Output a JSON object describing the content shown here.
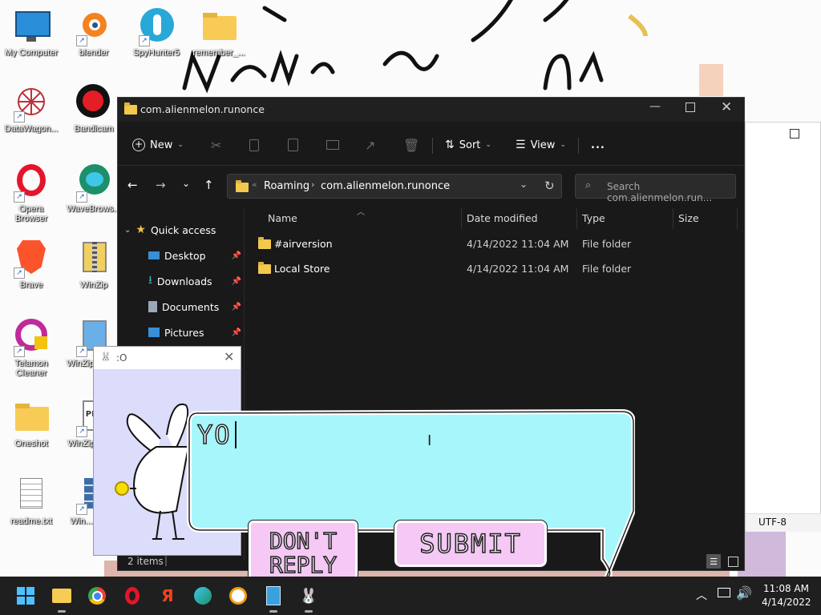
{
  "desktop": {
    "icons": [
      {
        "label": "My Computer"
      },
      {
        "label": "blender"
      },
      {
        "label": "SpyHunter5"
      },
      {
        "label": "remember_..."
      },
      {
        "label": "DataWagon..."
      },
      {
        "label": "Bandicam"
      },
      {
        "label": "Opera Browser"
      },
      {
        "label": "WaveBrows..."
      },
      {
        "label": "Brave"
      },
      {
        "label": "WinZip"
      },
      {
        "label": "Telamon Cleaner"
      },
      {
        "label": "WinZip Man..."
      },
      {
        "label": "Oneshot"
      },
      {
        "label": "WinZip Exp..."
      },
      {
        "label": "readme.txt"
      },
      {
        "label": "Win... Sec..."
      }
    ]
  },
  "explorer": {
    "title": "com.alienmelon.runonce",
    "toolbar": {
      "new": "New",
      "sort": "Sort",
      "view": "View",
      "more": "..."
    },
    "address": {
      "crumb1": "Roaming",
      "crumb2": "com.alienmelon.runonce",
      "overflow": "«"
    },
    "search": {
      "placeholder": "Search com.alienmelon.run..."
    },
    "nav": {
      "quick_access": "Quick access",
      "items": [
        {
          "label": "Desktop"
        },
        {
          "label": "Downloads"
        },
        {
          "label": "Documents"
        },
        {
          "label": "Pictures"
        }
      ]
    },
    "columns": {
      "name": "Name",
      "date": "Date modified",
      "type": "Type",
      "size": "Size"
    },
    "rows": [
      {
        "name": "#airversion",
        "date": "4/14/2022 11:04 AM",
        "type": "File folder"
      },
      {
        "name": "Local Store",
        "date": "4/14/2022 11:04 AM",
        "type": "File folder"
      }
    ],
    "status": {
      "count": "2 items",
      "sep": "|"
    }
  },
  "notepad": {
    "encoding": "UTF-8"
  },
  "pet": {
    "title": ":O",
    "bubble_text": "YO",
    "dont_reply": "DON'T REPLY",
    "submit": "SUBMIT"
  },
  "taskbar": {
    "time": "11:08 AM",
    "date": "4/14/2022"
  },
  "colors": {
    "bubble": "#a6f6fb",
    "button": "#f5c8f5",
    "explorer_bg": "#191919",
    "taskbar": "#1f1f1f"
  }
}
